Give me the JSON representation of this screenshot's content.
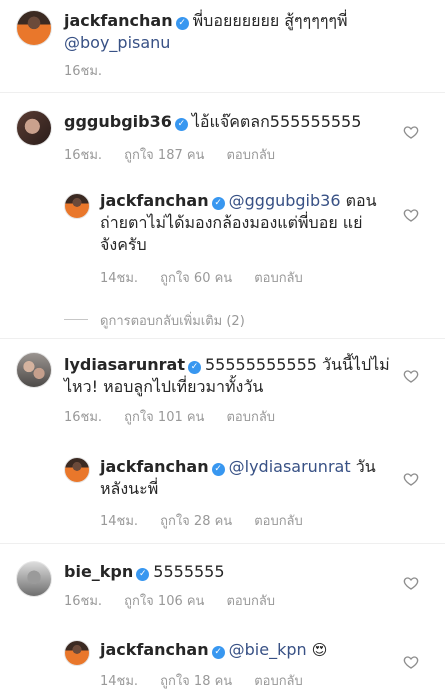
{
  "comments": [
    {
      "user": "jackfanchan",
      "text": "พี่บอยยยยยย สู้ๆๆๆๆๆพี่",
      "mention": "@boy_pisanu",
      "time": "16ชม."
    },
    {
      "user": "gggubgib36",
      "text": "ไอ้แจ๊คตลก555555555",
      "time": "16ชม.",
      "likes": "ถูกใจ 187 คน",
      "reply": "ตอบกลับ"
    },
    {
      "user": "jackfanchan",
      "mention": "@gggubgib36",
      "text_line1": "ตอน",
      "text_line2": "ถ่ายตาไม่ได้มองกล้องมองแต่พี่บอย แย่",
      "text_line3": "จังครับ",
      "time": "14ชม.",
      "likes": "ถูกใจ 60 คน",
      "reply": "ตอบกลับ"
    },
    {
      "view_more": "ดูการตอบกลับเพิ่มเติม (2)"
    },
    {
      "user": "lydiasarunrat",
      "text_line1": "55555555555 วันนี้ไปไม่",
      "text_line2": "ไหว! หอบลูกไปเที่ยวมาทั้งวัน",
      "time": "16ชม.",
      "likes": "ถูกใจ 101 คน",
      "reply": "ตอบกลับ"
    },
    {
      "user": "jackfanchan",
      "mention": "@lydiasarunrat",
      "text_line1": "วัน",
      "text_line2": "หลังนะพี่",
      "time": "14ชม.",
      "likes": "ถูกใจ 28 คน",
      "reply": "ตอบกลับ"
    },
    {
      "user": "bie_kpn",
      "text": "5555555",
      "time": "16ชม.",
      "likes": "ถูกใจ 106 คน",
      "reply": "ตอบกลับ"
    },
    {
      "user": "jackfanchan",
      "mention": "@bie_kpn",
      "emoji": "😍",
      "time": "14ชม.",
      "likes": "ถูกใจ 18 คน",
      "reply": "ตอบกลับ"
    }
  ],
  "colors": {
    "verified": "#3897f0",
    "mention": "#385185",
    "meta": "#999999"
  }
}
